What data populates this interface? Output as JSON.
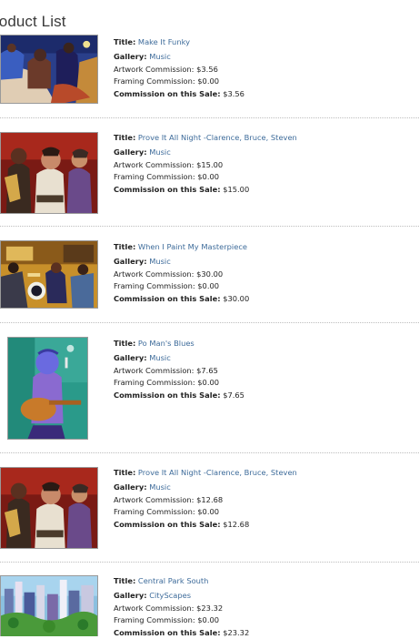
{
  "page": {
    "title": "roduct List"
  },
  "labels": {
    "title": "Title:",
    "gallery": "Gallery:",
    "artwork_commission": "Artwork Commission:",
    "framing_commission": "Framing Commission:",
    "commission_on_sale": "Commission on this Sale:"
  },
  "products": [
    {
      "title": "Make It Funky",
      "gallery": "Music",
      "artwork_commission": "$3.56",
      "framing_commission": "$0.00",
      "commission_on_sale": "$3.56"
    },
    {
      "title": "Prove It All Night -Clarence, Bruce, Steven",
      "gallery": "Music",
      "artwork_commission": "$15.00",
      "framing_commission": "$0.00",
      "commission_on_sale": "$15.00"
    },
    {
      "title": "When I Paint My Masterpiece",
      "gallery": "Music",
      "artwork_commission": "$30.00",
      "framing_commission": "$0.00",
      "commission_on_sale": "$30.00"
    },
    {
      "title": "Po Man's Blues",
      "gallery": "Music",
      "artwork_commission": "$7.65",
      "framing_commission": "$0.00",
      "commission_on_sale": "$7.65"
    },
    {
      "title": "Prove It All Night -Clarence, Bruce, Steven",
      "gallery": "Music",
      "artwork_commission": "$12.68",
      "framing_commission": "$0.00",
      "commission_on_sale": "$12.68"
    },
    {
      "title": "Central Park South",
      "gallery": "CityScapes",
      "artwork_commission": "$23.32",
      "framing_commission": "$0.00",
      "commission_on_sale": "$23.32"
    }
  ]
}
